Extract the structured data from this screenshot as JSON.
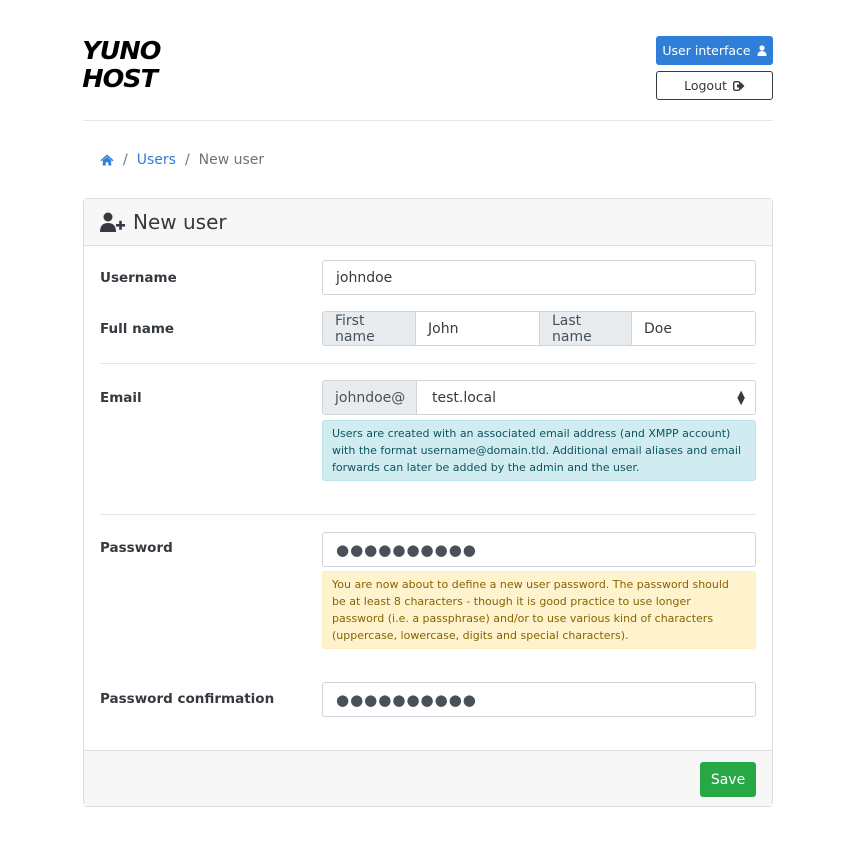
{
  "brand": {
    "logo_line1": "YUNO",
    "logo_line2": "HOST"
  },
  "header": {
    "user_interface_label": "User interface",
    "logout_label": "Logout"
  },
  "breadcrumb": {
    "home_icon": "home-icon",
    "items": [
      "Users",
      "New user"
    ]
  },
  "card": {
    "title": "New user",
    "title_icon": "user-plus-icon"
  },
  "form": {
    "username": {
      "label": "Username",
      "value": "johndoe"
    },
    "fullname": {
      "label": "Full name",
      "first_addon": "First name",
      "first_value": "John",
      "last_addon": "Last name",
      "last_value": "Doe"
    },
    "email": {
      "label": "Email",
      "prefix": "johndoe@",
      "domain_selected": "test.local",
      "help": "Users are created with an associated email address (and XMPP account) with the format username@domain.tld. Additional email aliases and email forwards can later be added by the admin and the user."
    },
    "password": {
      "label": "Password",
      "masked": "●●●●●●●●●●",
      "help": "You are now about to define a new user password. The password should be at least 8 characters - though it is good practice to use longer password (i.e. a passphrase) and/or to use various kind of characters (uppercase, lowercase, digits and special characters)."
    },
    "password_confirmation": {
      "label": "Password confirmation",
      "masked": "●●●●●●●●●●"
    }
  },
  "footer": {
    "save_label": "Save"
  },
  "colors": {
    "primary": "#2f7ed8",
    "success": "#28a745"
  }
}
